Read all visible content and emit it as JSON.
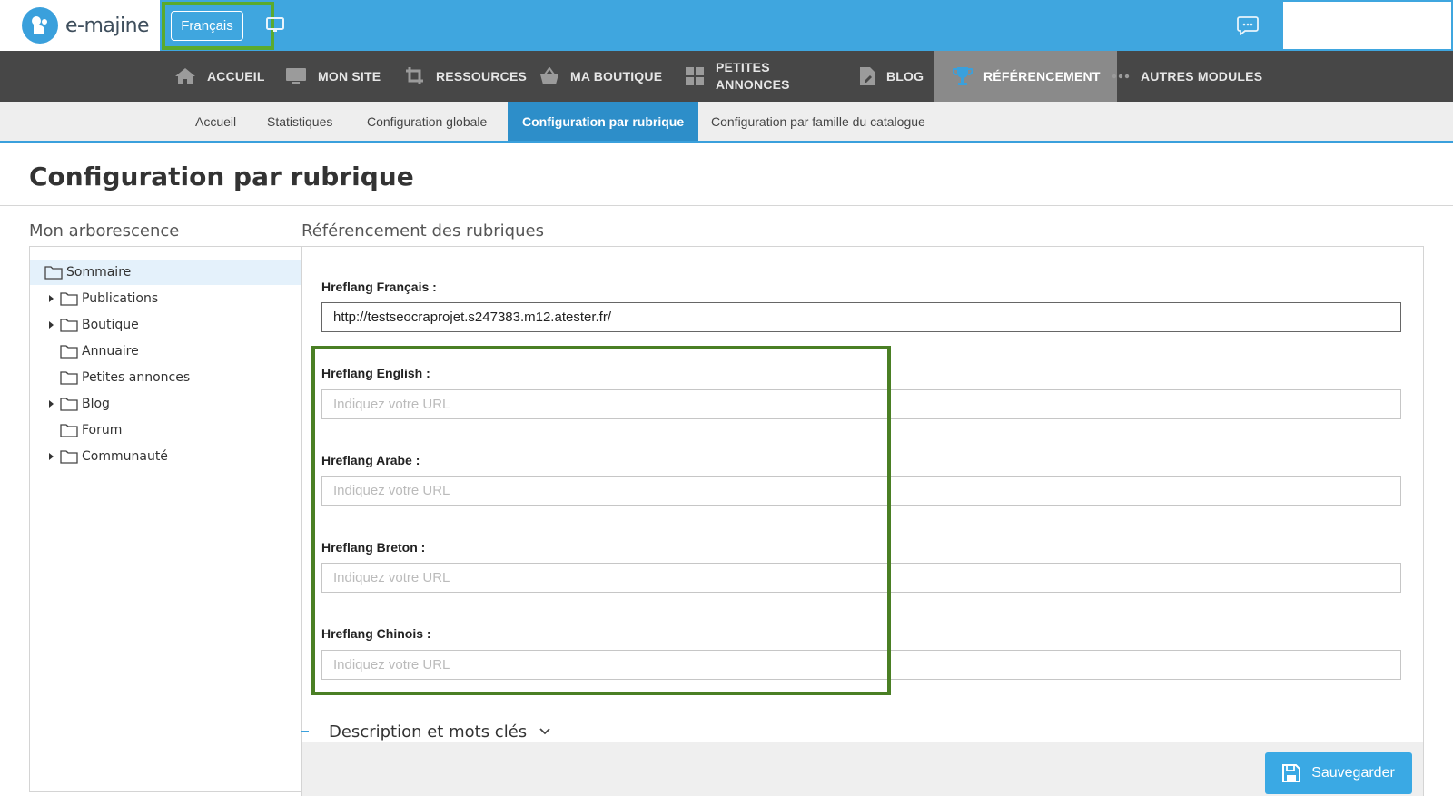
{
  "app": {
    "brand": "e-majine",
    "language_button": "Français"
  },
  "mainnav": {
    "items": [
      {
        "label": "ACCUEIL",
        "icon": "home-icon"
      },
      {
        "label": "MON SITE",
        "icon": "monitor-icon"
      },
      {
        "label": "RESSOURCES",
        "icon": "crop-icon"
      },
      {
        "label": "MA BOUTIQUE",
        "icon": "basket-icon"
      },
      {
        "label_line1": "PETITES",
        "label_line2": "ANNONCES",
        "icon": "grid-icon"
      },
      {
        "label": "BLOG",
        "icon": "document-pen-icon"
      },
      {
        "label": "RÉFÉRENCEMENT",
        "icon": "trophy-icon",
        "active": true
      },
      {
        "label": "AUTRES MODULES",
        "icon": "dots-icon"
      }
    ]
  },
  "subnav": {
    "items": [
      {
        "label": "Accueil"
      },
      {
        "label": "Statistiques"
      },
      {
        "label": "Configuration globale"
      },
      {
        "label": "Configuration par rubrique",
        "active": true
      },
      {
        "label": "Configuration par famille du catalogue"
      }
    ]
  },
  "page": {
    "title": "Configuration par rubrique",
    "tree_heading": "Mon arborescence",
    "content_heading": "Référencement des rubriques"
  },
  "tree": {
    "root": "Sommaire",
    "items": [
      {
        "label": "Publications",
        "expandable": true
      },
      {
        "label": "Boutique",
        "expandable": true
      },
      {
        "label": "Annuaire",
        "expandable": false
      },
      {
        "label": "Petites annonces",
        "expandable": false
      },
      {
        "label": "Blog",
        "expandable": true
      },
      {
        "label": "Forum",
        "expandable": false
      },
      {
        "label": "Communauté",
        "expandable": true
      }
    ]
  },
  "form": {
    "fields": [
      {
        "label": "Hreflang Français :",
        "value": "http://testseocraprojet.s247383.m12.atester.fr/",
        "placeholder": ""
      },
      {
        "label": "Hreflang English :",
        "value": "",
        "placeholder": "Indiquez votre URL"
      },
      {
        "label": "Hreflang Arabe :",
        "value": "",
        "placeholder": "Indiquez votre URL"
      },
      {
        "label": "Hreflang Breton :",
        "value": "",
        "placeholder": "Indiquez votre URL"
      },
      {
        "label": "Hreflang Chinois :",
        "value": "",
        "placeholder": "Indiquez votre URL"
      }
    ],
    "section_toggle": "Description et mots clés",
    "save_label": "Sauvegarder"
  },
  "colors": {
    "topbar": "#3fa6df",
    "mainnav": "#474747",
    "active_tab": "#2d8ec9",
    "highlight_green": "#4a7f24",
    "save_button": "#3aa9e4"
  }
}
